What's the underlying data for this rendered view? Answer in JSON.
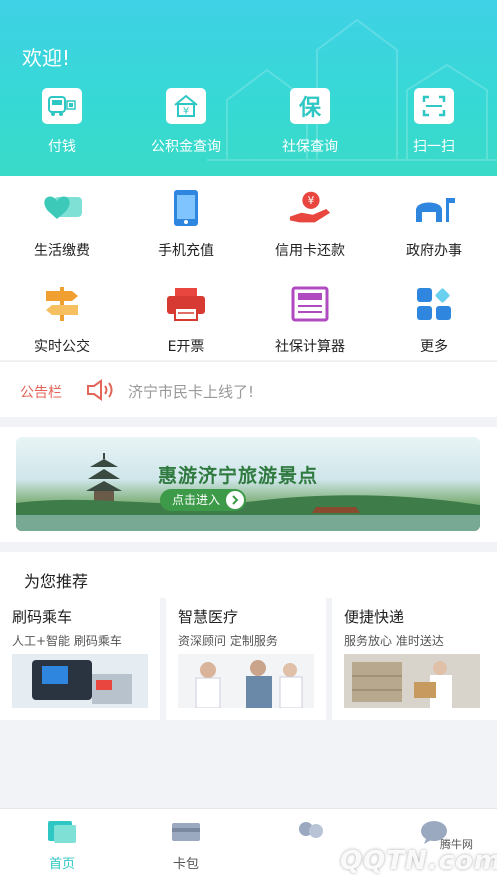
{
  "header": {
    "welcome": "欢迎!",
    "quick_actions": [
      {
        "label": "付钱",
        "icon": "bus-qr-icon"
      },
      {
        "label": "公积金查询",
        "icon": "house-yuan-icon"
      },
      {
        "label": "社保查询",
        "icon": "bao-icon"
      },
      {
        "label": "扫一扫",
        "icon": "scan-icon"
      }
    ]
  },
  "services": [
    {
      "label": "生活缴费",
      "icon": "heart-card-icon"
    },
    {
      "label": "手机充值",
      "icon": "phone-icon"
    },
    {
      "label": "信用卡还款",
      "icon": "hand-coin-icon"
    },
    {
      "label": "政府办事",
      "icon": "government-icon"
    },
    {
      "label": "实时公交",
      "icon": "signpost-icon"
    },
    {
      "label": "E开票",
      "icon": "printer-icon"
    },
    {
      "label": "社保计算器",
      "icon": "calculator-icon"
    },
    {
      "label": "更多",
      "icon": "more-grid-icon"
    }
  ],
  "notice": {
    "title": "公告栏",
    "text": "济宁市民卡上线了!"
  },
  "banner": {
    "title": "惠游济宁旅游景点",
    "button": "点击进入"
  },
  "recommend": {
    "title": "为您推荐",
    "cards": [
      {
        "title": "刷码乘车",
        "subtitle": "人工+智能 刷码乘车"
      },
      {
        "title": "智慧医疗",
        "subtitle": "资深顾问 定制服务"
      },
      {
        "title": "便捷快递",
        "subtitle": "服务放心 准时送达"
      }
    ]
  },
  "tabbar": {
    "tabs": [
      {
        "label": "首页",
        "active": true
      },
      {
        "label": "卡包",
        "active": false
      },
      {
        "label": "",
        "active": false
      },
      {
        "label": "",
        "active": false
      }
    ]
  },
  "watermark": {
    "brand": "QQTN.com",
    "sub": "腾牛网"
  },
  "colors": {
    "header_gradient_top": "#3fd1e6",
    "header_gradient_bottom": "#3adac8",
    "accent": "#2fc7c4",
    "notice_red": "#e3655a"
  }
}
